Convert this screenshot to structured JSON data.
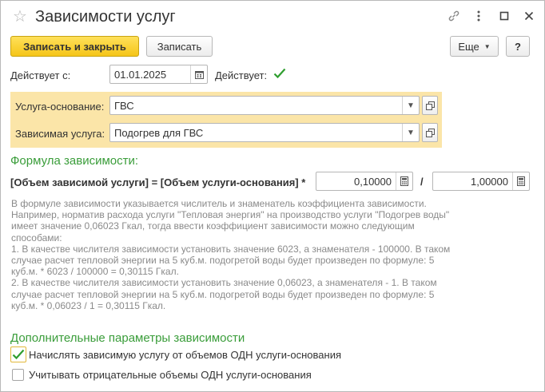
{
  "window": {
    "title": "Зависимости услуг",
    "icons": [
      "star-icon",
      "link-icon",
      "more-icon",
      "maximize-icon",
      "close-icon"
    ]
  },
  "toolbar": {
    "save_close_label": "Записать и закрыть",
    "save_label": "Записать",
    "more_label": "Еще",
    "help_label": "?"
  },
  "form": {
    "active_from_label": "Действует с:",
    "active_from_value": "01.01.2025",
    "active_label": "Действует:",
    "active_checked": true,
    "base_service_label": "Услуга-основание:",
    "base_service_value": "ГВС",
    "dependent_service_label": "Зависимая услуга:",
    "dependent_service_value": "Подогрев для ГВС"
  },
  "formula": {
    "heading": "Формула зависимости:",
    "expression": "[Объем зависимой услуги] = [Объем услуги-основания] *",
    "numerator": "0,10000",
    "divider": "/",
    "denominator": "1,00000",
    "description": [
      "В формуле зависимости указывается числитель и знаменатель коэффициента зависимости.",
      "Например, норматив расхода услуги \"Тепловая энергия\" на производство услуги \"Подогрев воды\"",
      "имеет значение 0,06023 Гкал, тогда ввести коэффициент зависимости можно следующим",
      "способами:",
      "1. В качестве числителя зависимости установить значение 6023, а знаменателя - 100000. В таком",
      "случае расчет тепловой энергии на 5 куб.м. подогретой воды будет произведен по формуле: 5",
      "куб.м. * 6023 / 100000 = 0,30115 Гкал.",
      "2. В качестве числителя зависимости установить значение 0,06023, а знаменателя - 1. В таком",
      "случае расчет тепловой энергии на 5 куб.м. подогретой воды будет произведен по формуле: 5",
      "куб.м. * 0,06023 / 1 = 0,30115 Гкал."
    ]
  },
  "additional": {
    "heading": "Дополнительные параметры зависимости",
    "option1_label": "Начислять зависимую услугу от объемов ОДН услуги-основания",
    "option1_checked": true,
    "option2_label": "Учитывать отрицательные объемы ОДН услуги-основания",
    "option2_checked": false
  },
  "colors": {
    "accent_green": "#3a9d3a",
    "highlight": "#fbe5a8",
    "primary_button": "#f5c518"
  }
}
